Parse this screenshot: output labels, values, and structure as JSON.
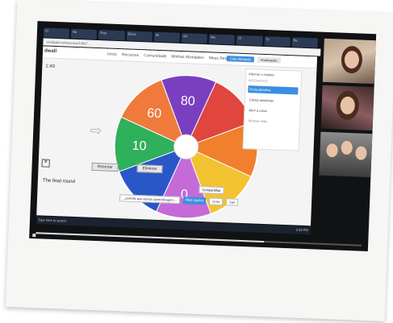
{
  "browser": {
    "tabs": [
      "Cl",
      "Ba",
      "Prat",
      "Eleva",
      "Mi",
      "Ad",
      "Ma",
      "Cl",
      "Ty",
      "Ba"
    ],
    "url": "wordwall.net/resource/13567..."
  },
  "app": {
    "brand": "dwall",
    "nav": [
      "Início",
      "Recursos",
      "Comunidade",
      "Minhas Atividades",
      "Meus Resultados"
    ],
    "create_button": "Criar Atividade",
    "upgrade_button": "Atualização",
    "timer": "1:40",
    "side_panel": {
      "title": "Alternar o modelo",
      "subtitle": "INTERATIVO",
      "items": [
        "Roda aleatória",
        "Cartas aleatórias",
        "Abrir a caixa"
      ],
      "more": "Mostrar mais"
    },
    "wheel": {
      "segments": [
        {
          "label": "80",
          "color": "#7a3fc0"
        },
        {
          "label": "",
          "color": "#e0453e"
        },
        {
          "label": "",
          "color": "#f07f2e"
        },
        {
          "label": "",
          "color": "#f2c230"
        },
        {
          "label": "0",
          "color": "#c46bd8"
        },
        {
          "label": "",
          "color": "#2a57c8"
        },
        {
          "label": "10",
          "color": "#2fb05a"
        },
        {
          "label": "60",
          "color": "#ef7a3c"
        }
      ]
    },
    "retomar_button": "Retomar",
    "eliminar_button": "Eliminar",
    "menu_icon": "menu-icon",
    "caption": "The final round",
    "share_button": "Compartilhar",
    "footer": [
      "...permitir aos alunos aprendizagem...",
      "Mais opções",
      "Criar",
      "Sair"
    ]
  },
  "taskbar": {
    "search": "Type here to search",
    "clock": "2:59 PM"
  },
  "video": {
    "progress": 0.7
  }
}
